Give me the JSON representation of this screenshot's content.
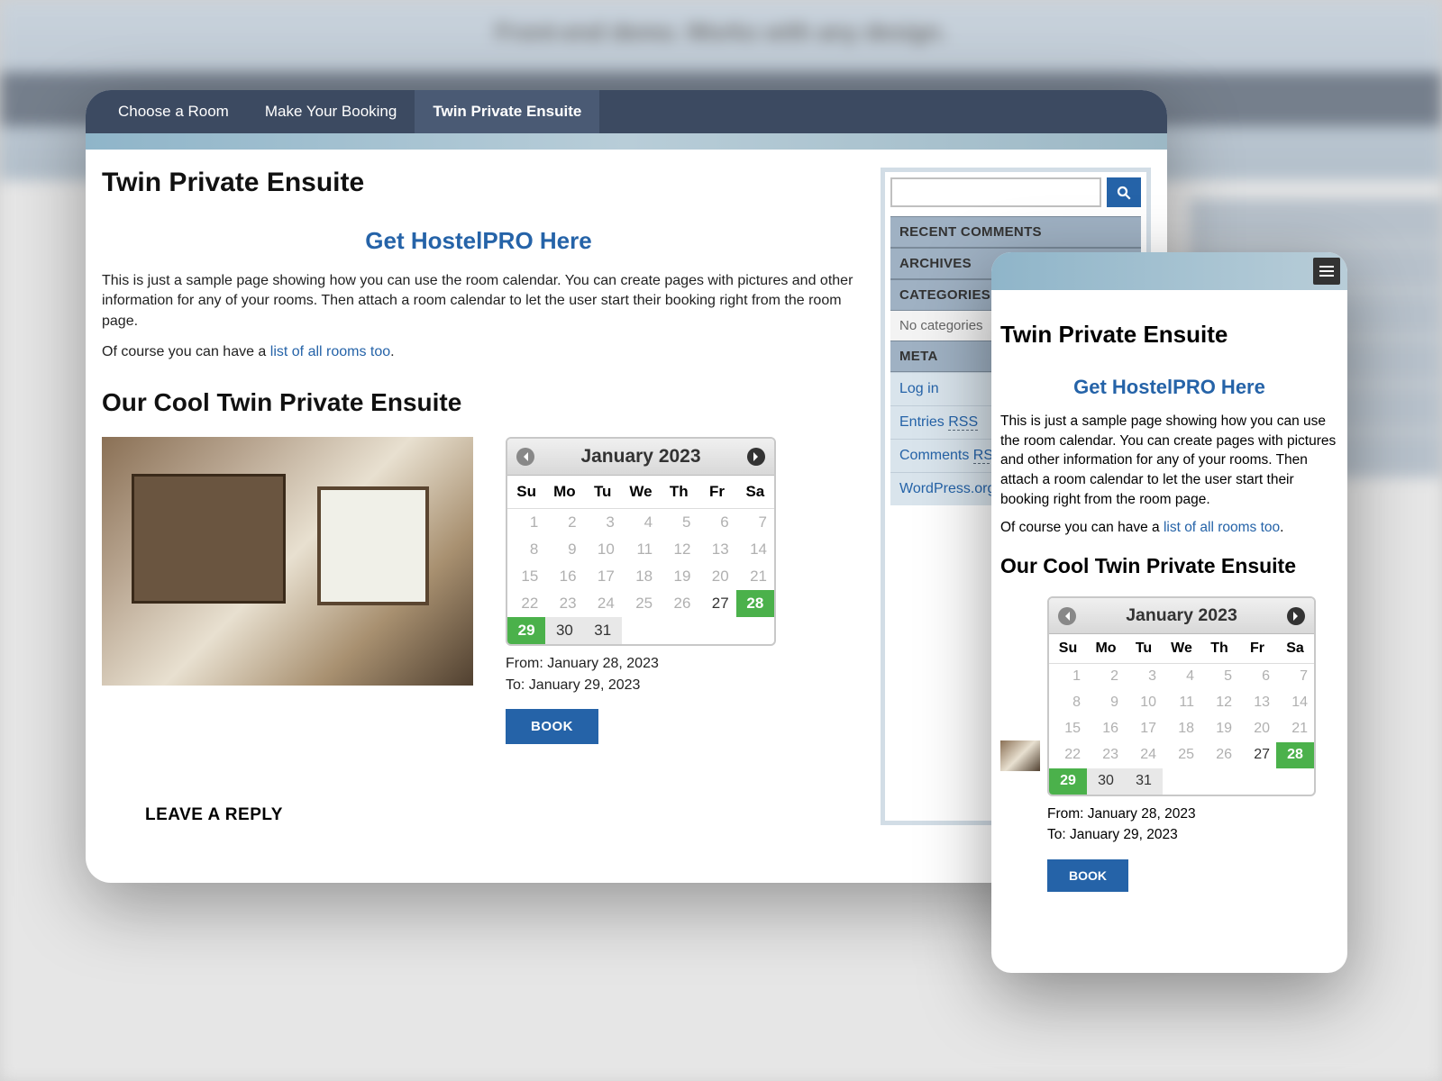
{
  "background_tagline": "Front-end demo. Works with any design.",
  "nav": {
    "items": [
      {
        "label": "Choose a Room"
      },
      {
        "label": "Make Your Booking"
      },
      {
        "label": "Twin Private Ensuite"
      }
    ]
  },
  "page": {
    "title": "Twin Private Ensuite",
    "promo_link": "Get HostelPRO Here",
    "intro": "This is just a sample page showing how you can use the room calendar. You can create pages with pictures and other information for any of your rooms. Then attach a room calendar to let the user start their booking right from the room page.",
    "list_prefix": "Of course you can have a ",
    "list_link": "list of all rooms too",
    "list_suffix": ".",
    "section_title": "Our Cool Twin Private Ensuite",
    "leave_reply": "LEAVE A REPLY"
  },
  "calendar": {
    "title": "January 2023",
    "dow": [
      "Su",
      "Mo",
      "Tu",
      "We",
      "Th",
      "Fr",
      "Sa"
    ],
    "weeks": [
      [
        {
          "n": "1"
        },
        {
          "n": "2"
        },
        {
          "n": "3"
        },
        {
          "n": "4"
        },
        {
          "n": "5"
        },
        {
          "n": "6"
        },
        {
          "n": "7"
        }
      ],
      [
        {
          "n": "8"
        },
        {
          "n": "9"
        },
        {
          "n": "10"
        },
        {
          "n": "11"
        },
        {
          "n": "12"
        },
        {
          "n": "13"
        },
        {
          "n": "14"
        }
      ],
      [
        {
          "n": "15"
        },
        {
          "n": "16"
        },
        {
          "n": "17"
        },
        {
          "n": "18"
        },
        {
          "n": "19"
        },
        {
          "n": "20"
        },
        {
          "n": "21"
        }
      ],
      [
        {
          "n": "22"
        },
        {
          "n": "23"
        },
        {
          "n": "24"
        },
        {
          "n": "25"
        },
        {
          "n": "26"
        },
        {
          "n": "27",
          "cls": "avail"
        },
        {
          "n": "28",
          "cls": "selected-end"
        }
      ],
      [
        {
          "n": "29",
          "cls": "selected-start"
        },
        {
          "n": "30",
          "cls": "in-range"
        },
        {
          "n": "31",
          "cls": "in-range"
        },
        {
          "n": ""
        },
        {
          "n": ""
        },
        {
          "n": ""
        },
        {
          "n": ""
        }
      ]
    ],
    "from_label": "From: ",
    "from_date": "January 28, 2023",
    "to_label": "To: ",
    "to_date": "January 29, 2023",
    "book_label": "BOOK"
  },
  "sidebar": {
    "search_placeholder": "",
    "recent_comments_title": "RECENT COMMENTS",
    "archives_title": "ARCHIVES",
    "categories_title": "CATEGORIES",
    "no_categories": "No categories",
    "meta_title": "META",
    "meta_items": [
      {
        "label": "Log in"
      },
      {
        "label": "Entries ",
        "suffix": "RSS",
        "rss": true
      },
      {
        "label": "Comments ",
        "suffix": "RSS",
        "rss": true
      },
      {
        "label": "WordPress.org"
      }
    ]
  }
}
